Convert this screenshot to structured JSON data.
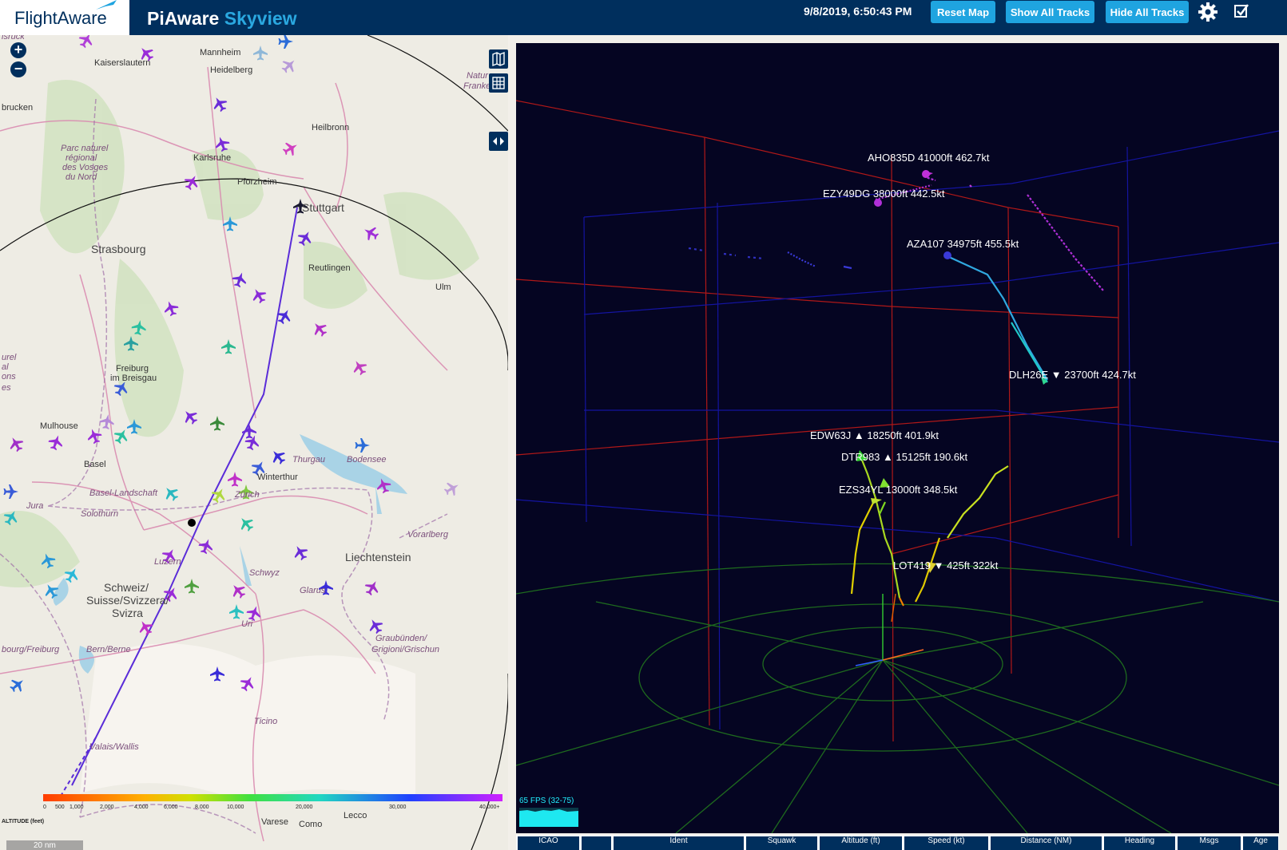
{
  "header": {
    "logo_text": "FlightAware",
    "app_title_a": "PiAware",
    "app_title_b": "Skyview",
    "timestamp": "9/8/2019, 6:50:43 PM",
    "reset_label": "Reset Map",
    "show_label": "Show All Tracks",
    "hide_label": "Hide All Tracks"
  },
  "map": {
    "zoom_in": "+",
    "zoom_out": "−",
    "labels": [
      {
        "text": "Mannheim",
        "cls": ""
      },
      {
        "text": "Kaiserslautern",
        "cls": ""
      },
      {
        "text": "Heidelberg",
        "cls": ""
      },
      {
        "text": "brucken",
        "cls": ""
      },
      {
        "text": "Heilbronn",
        "cls": ""
      },
      {
        "text": "Parc naturel",
        "cls": "it"
      },
      {
        "text": "régional",
        "cls": "it"
      },
      {
        "text": "des Vosges",
        "cls": "it"
      },
      {
        "text": "du Nord",
        "cls": "it"
      },
      {
        "text": "Karlsruhe",
        "cls": ""
      },
      {
        "text": "Pforzheim",
        "cls": ""
      },
      {
        "text": "Stuttgart",
        "cls": "big"
      },
      {
        "text": "Strasbourg",
        "cls": "big"
      },
      {
        "text": "Reutlingen",
        "cls": ""
      },
      {
        "text": "Ulm",
        "cls": ""
      },
      {
        "text": "Freiburg",
        "cls": ""
      },
      {
        "text": "im Breisgau",
        "cls": ""
      },
      {
        "text": "Mulhouse",
        "cls": ""
      },
      {
        "text": "Basel",
        "cls": ""
      },
      {
        "text": "Thurgau",
        "cls": "it"
      },
      {
        "text": "Bodensee",
        "cls": "it"
      },
      {
        "text": "Winterthur",
        "cls": ""
      },
      {
        "text": "Basel-Landschaft",
        "cls": "it"
      },
      {
        "text": "Zürich",
        "cls": "it"
      },
      {
        "text": "Jura",
        "cls": "it"
      },
      {
        "text": "Solothurn",
        "cls": "it"
      },
      {
        "text": "Vorarlberg",
        "cls": "it"
      },
      {
        "text": "Liechtenstein",
        "cls": "big"
      },
      {
        "text": "Luzern",
        "cls": "it"
      },
      {
        "text": "Schwyz",
        "cls": "it"
      },
      {
        "text": "Schweiz/",
        "cls": "big"
      },
      {
        "text": "Suisse/Svizzera/",
        "cls": "big"
      },
      {
        "text": "Svizra",
        "cls": "big"
      },
      {
        "text": "Glarus",
        "cls": "it"
      },
      {
        "text": "Uri",
        "cls": "it"
      },
      {
        "text": "Graubünden/",
        "cls": "it"
      },
      {
        "text": "Grigioni/Grischun",
        "cls": "it"
      },
      {
        "text": "bourg/Freiburg",
        "cls": "it"
      },
      {
        "text": "Bern/Berne",
        "cls": "it"
      },
      {
        "text": "Ticino",
        "cls": "it"
      },
      {
        "text": "Valais/Wallis",
        "cls": "it"
      },
      {
        "text": "Varese",
        "cls": ""
      },
      {
        "text": "Como",
        "cls": ""
      },
      {
        "text": "Lecco",
        "cls": ""
      },
      {
        "text": "Natur",
        "cls": "it"
      },
      {
        "text": "Franke",
        "cls": "it"
      },
      {
        "text": "isruck",
        "cls": "it"
      },
      {
        "text": "urel",
        "cls": "it"
      },
      {
        "text": "al",
        "cls": "it"
      },
      {
        "text": "ons",
        "cls": "it"
      },
      {
        "text": "es",
        "cls": "it"
      }
    ],
    "altitude_legend": {
      "title": "ALTITUDE (feet)",
      "ticks": [
        "0",
        "500",
        "1,000",
        "2,000",
        "4,000",
        "6,000",
        "8,000",
        "10,000",
        "20,000",
        "30,000",
        "40,000+"
      ]
    },
    "scale": "20 nm"
  },
  "view3d": {
    "fps": "65 FPS (32-75)",
    "flights": [
      {
        "label": "AHO835D   41000ft 462.7kt"
      },
      {
        "label": "EZY49DG   38000ft 442.5kt"
      },
      {
        "label": "AZA107   34975ft 455.5kt"
      },
      {
        "label": "DLH26E ▼ 23700ft 424.7kt"
      },
      {
        "label": "EDW63J ▲ 18250ft 401.9kt"
      },
      {
        "label": "DTR983 ▲ 15125ft 190.6kt"
      },
      {
        "label": "EZS34YL   13000ft 348.5kt"
      },
      {
        "label": "LOT419 ▼ 425ft 322kt"
      }
    ]
  },
  "table_headers": [
    "ICAO",
    "",
    "Ident",
    "Squawk",
    "Altitude (ft)",
    "Speed (kt)",
    "Distance (NM)",
    "Heading",
    "Msgs",
    "Age"
  ]
}
